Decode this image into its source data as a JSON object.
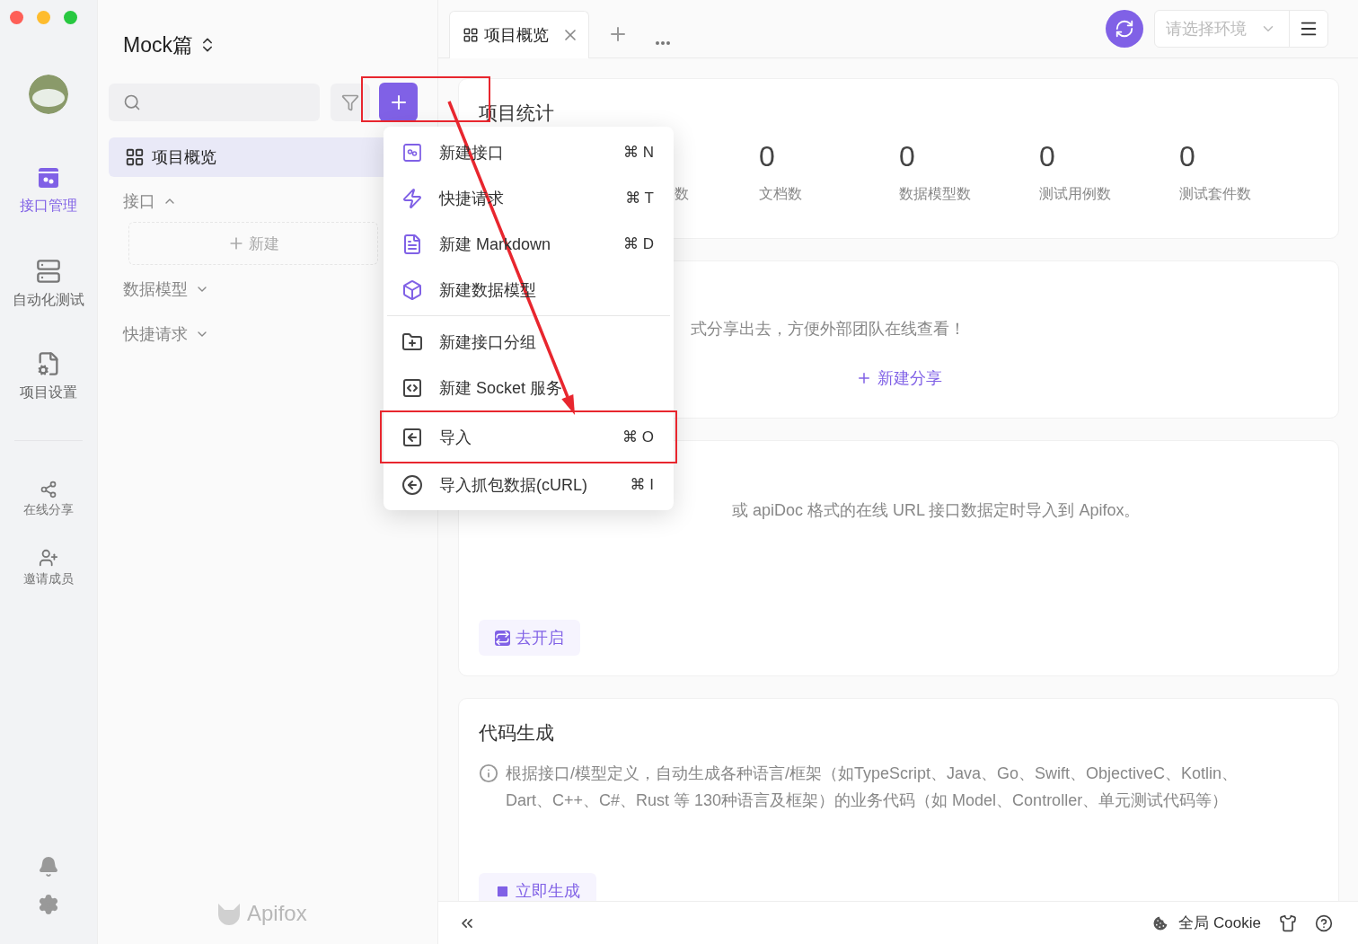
{
  "window": {
    "traffic_lights": [
      {
        "color": "#fe5f57"
      },
      {
        "color": "#febc2e"
      },
      {
        "color": "#28c840"
      }
    ]
  },
  "rail": {
    "items": [
      {
        "kind": "api",
        "label": "接口管理",
        "selected": true
      },
      {
        "kind": "automation",
        "label": "自动化测试",
        "selected": false
      },
      {
        "kind": "settings",
        "label": "项目设置",
        "selected": false
      }
    ],
    "secondary": [
      {
        "kind": "share",
        "label": "在线分享"
      },
      {
        "kind": "invite",
        "label": "邀请成员"
      }
    ]
  },
  "sidebar": {
    "project": "Mock篇",
    "items": [
      {
        "kind": "overview",
        "label": "项目概览",
        "selected": true
      },
      {
        "kind": "group",
        "label": "接口",
        "expanded": true,
        "new_label": "新建"
      },
      {
        "kind": "group",
        "label": "数据模型",
        "expanded": false
      },
      {
        "kind": "group",
        "label": "快捷请求",
        "expanded": false
      }
    ],
    "brand": "Apifox"
  },
  "tabs": [
    {
      "label": "项目概览",
      "selected": true
    }
  ],
  "environment": {
    "placeholder": "请选择环境"
  },
  "stats_card": {
    "title": "项目统计",
    "stats": [
      {
        "label": "数"
      },
      {
        "value": "0",
        "label": "文档数"
      },
      {
        "value": "0",
        "label": "数据模型数"
      },
      {
        "value": "0",
        "label": "测试用例数"
      },
      {
        "value": "0",
        "label": "测试套件数"
      }
    ]
  },
  "share_card": {
    "description": "式分享出去，方便外部团队在线查看！",
    "action": "新建分享"
  },
  "import_card": {
    "description": "或 apiDoc 格式的在线 URL 接口数据定时导入到 Apifox。",
    "action": "去开启"
  },
  "codegen_card": {
    "title": "代码生成",
    "description": "根据接口/模型定义，自动生成各种语言/框架（如TypeScript、Java、Go、Swift、ObjectiveC、Kotlin、Dart、C++、C#、Rust 等 130种语言及框架）的业务代码（如 Model、Controller、单元测试代码等）",
    "action": "立即生成"
  },
  "menu": {
    "sections": [
      {
        "items": [
          {
            "kind": "api",
            "label": "新建接口",
            "shortcut": "⌘ N",
            "annotated": false
          },
          {
            "kind": "quick",
            "label": "快捷请求",
            "shortcut": "⌘ T",
            "annotated": false
          },
          {
            "kind": "markdown",
            "label": "新建 Markdown",
            "shortcut": "⌘ D",
            "annotated": false
          },
          {
            "kind": "model",
            "label": "新建数据模型",
            "annotated": false
          }
        ]
      },
      {
        "items": [
          {
            "kind": "folder",
            "label": "新建接口分组",
            "annotated": false
          },
          {
            "kind": "socket",
            "label": "新建 Socket 服务",
            "annotated": false
          },
          {
            "kind": "import",
            "label": "导入",
            "shortcut": "⌘ O",
            "annotated": true
          },
          {
            "kind": "curl",
            "label": "导入抓包数据(cURL)",
            "shortcut": "⌘ I",
            "annotated": false
          }
        ]
      }
    ]
  },
  "annotations": {
    "plus_button_box": true,
    "arrow": true
  },
  "status_bar": {
    "cookie": "全局 Cookie"
  }
}
